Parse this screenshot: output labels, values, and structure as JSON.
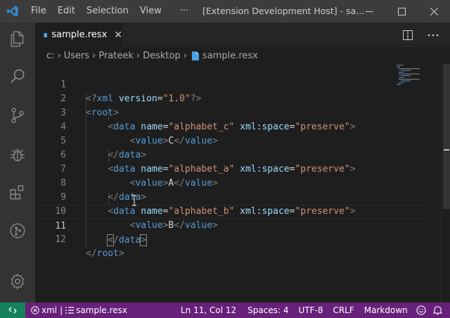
{
  "titlebar": {
    "menu": [
      {
        "label": "File"
      },
      {
        "label": "Edit"
      },
      {
        "label": "Selection"
      },
      {
        "label": "View"
      },
      {
        "label": "···"
      }
    ],
    "window_title": "[Extension Development Host] - sa..."
  },
  "activitybar": {
    "icons": [
      "files-icon",
      "search-icon",
      "source-control-icon",
      "debug-icon",
      "extensions-icon",
      "git-graph-icon",
      "settings-gear-icon"
    ]
  },
  "tabs": [
    {
      "label": "sample.resx",
      "close": "✕"
    }
  ],
  "breadcrumb": {
    "items": [
      "c:",
      "Users",
      "Prateek",
      "Desktop",
      "sample.resx"
    ],
    "separator": "›"
  },
  "editor": {
    "active_line": 11,
    "lines": [
      {
        "num": "1"
      },
      {
        "num": "2"
      },
      {
        "num": "3"
      },
      {
        "num": "4"
      },
      {
        "num": "5"
      },
      {
        "num": "6"
      },
      {
        "num": "7"
      },
      {
        "num": "8"
      },
      {
        "num": "9"
      },
      {
        "num": "10"
      },
      {
        "num": "11"
      },
      {
        "num": "12"
      }
    ],
    "tokens": {
      "l1_open": "<?",
      "l1_tag": "xml",
      "l1_attr": "version",
      "l1_eq": "=",
      "l1_val": "\"1.0\"",
      "l1_close": "?>",
      "root": "root",
      "data": "data",
      "value": "value",
      "name_attr": "name",
      "space_attr": "xml:space",
      "preserve": "\"preserve\"",
      "names": [
        "\"alphabet_c\"",
        "\"alphabet_a\"",
        "\"alphabet_b\""
      ],
      "values": [
        "C",
        "A",
        "B"
      ]
    }
  },
  "statusbar": {
    "remote_icon": "remote-icon",
    "problems": "xml",
    "separator": "|",
    "file_symbol": "sample.resx",
    "position": "Ln 11, Col 12",
    "spaces": "Spaces: 4",
    "encoding": "UTF-8",
    "eol": "CRLF",
    "language": "Markdown"
  },
  "colors": {
    "statusbar": "#68217a",
    "remote": "#16825d",
    "titlebar": "#3c3c3c",
    "activitybar": "#333333",
    "editor_bg": "#1e1e1e",
    "tag": "#569cd6",
    "attr": "#9cdcfe",
    "string": "#ce9178"
  }
}
